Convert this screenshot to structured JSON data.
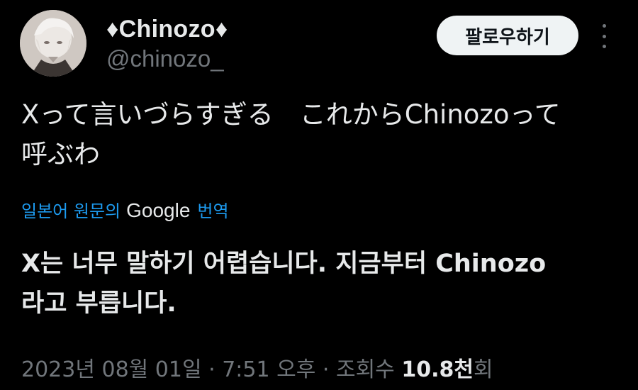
{
  "author": {
    "display_name": "♦Chinozo♦",
    "handle": "@chinozo_"
  },
  "follow_button": {
    "label": "팔로우하기"
  },
  "more_icon": "more-horizontal-icon",
  "tweet": {
    "text_lines": [
      "Xって言いづらすぎる　これからChinozoって",
      "呼ぶわ"
    ]
  },
  "translation": {
    "prefix": "일본어 원문의",
    "google": "Google",
    "suffix": "번역",
    "text_lines": [
      "X는 너무 말하기 어렵습니다. 지금부터 Chinozo",
      "라고 부릅니다."
    ]
  },
  "meta": {
    "date": "2023년 08월 01일",
    "separator": "·",
    "time": "7:51 오후",
    "views_label": "조회수",
    "views_count": "10.8천",
    "views_suffix": "회"
  },
  "colors": {
    "background": "#000000",
    "text": "#e7e9ea",
    "secondary": "#71767b",
    "link": "#1d9bf0",
    "button_bg": "#eff3f4"
  }
}
